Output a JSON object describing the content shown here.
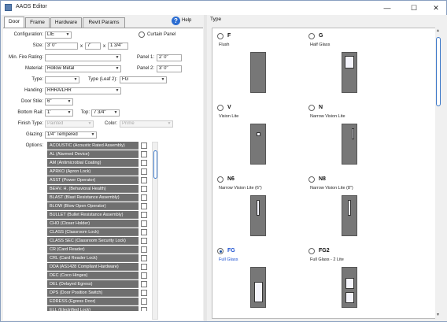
{
  "window": {
    "title": "AAOS Editor",
    "minimize": "—",
    "maximize": "☐",
    "close": "✕"
  },
  "tabs": [
    "Door",
    "Frame",
    "Hardware",
    "Revit Params"
  ],
  "help": "Help",
  "form": {
    "configuration": {
      "label": "Configuration:",
      "value": "LIE"
    },
    "curtain_panel": "Curtain Panel",
    "size": {
      "label": "Size:",
      "w": "3' 0\"",
      "h": "7'",
      "t": "1 3/4\"",
      "x": "x"
    },
    "min_fire_rating": {
      "label": "Min. Fire Rating:",
      "value": ""
    },
    "panel1": {
      "label": "Panel 1:",
      "value": "2' 0\""
    },
    "material": {
      "label": "Material:",
      "value": "Hollow Metal"
    },
    "panel2": {
      "label": "Panel 2:",
      "value": "3' 0\""
    },
    "type": {
      "label": "Type:",
      "value": ""
    },
    "type_leaf2": {
      "label": "Type (Leaf 2):",
      "value": "FG"
    },
    "handing": {
      "label": "Handing:",
      "value": "RHRA/LHR"
    },
    "door_stile": {
      "label": "Door Stile:",
      "value": "6\""
    },
    "bottom_rail": {
      "label": "Bottom Rail:",
      "value": "1'"
    },
    "top": {
      "label": "Top:",
      "value": "7 3/4\""
    },
    "finish_type": {
      "label": "Finish Type:",
      "value": "Painted"
    },
    "color": {
      "label": "Color:",
      "value": "Prime"
    },
    "glazing": {
      "label": "Glazing:",
      "value": "1/4\" Tempered"
    },
    "options_label": "Options:"
  },
  "options": [
    "ACOUSTIC (Acoustic Rated Assembly)",
    "AL (Alarmed Device)",
    "AM (Antimicrobial Coating)",
    "APRKO (Apron Lock)",
    "ASST (Power Operator)",
    "BEHV. H. (Behavioral Health)",
    "BLAST (Blast Resistance Assembly)",
    "BLOW (Blow Open Operator)",
    "BULLET (Bullet Resistance Assembly)",
    "CHO (Closer Holder)",
    "CLASS (Classroom Lock)",
    "CLASS SEC (Classroom Security Lock)",
    "CR (Card Reader)",
    "CRL (Card Reader Lock)",
    "DDA (AS1428 Compliant Hardware)",
    "DEC (Coco Hinges)",
    "DEL (Delayed Egress)",
    "DPS (Door Position Switch)",
    "EDRESS (Egress Door)",
    "ELL (Electrified Lock)"
  ],
  "type_panel": {
    "header": "Type",
    "items": [
      {
        "code": "F",
        "desc": "Flush",
        "vision": "none",
        "selected": false
      },
      {
        "code": "G",
        "desc": "Half Glass",
        "vision": "half",
        "selected": false
      },
      {
        "code": "V",
        "desc": "Vision Lite",
        "vision": "small",
        "selected": false
      },
      {
        "code": "N",
        "desc": "Narrow Vision Lite",
        "vision": "narrow",
        "selected": false
      },
      {
        "code": "N6",
        "desc": "Narrow Vision Lite (6\")",
        "vision": "narrow-tall",
        "selected": false
      },
      {
        "code": "N8",
        "desc": "Narrow Vision Lite (8\")",
        "vision": "narrow-tall",
        "selected": false
      },
      {
        "code": "FG",
        "desc": "Full Glass",
        "vision": "full",
        "selected": true
      },
      {
        "code": "FG2",
        "desc": "Full Glass - 2 Lite",
        "vision": "two",
        "selected": false
      }
    ]
  }
}
